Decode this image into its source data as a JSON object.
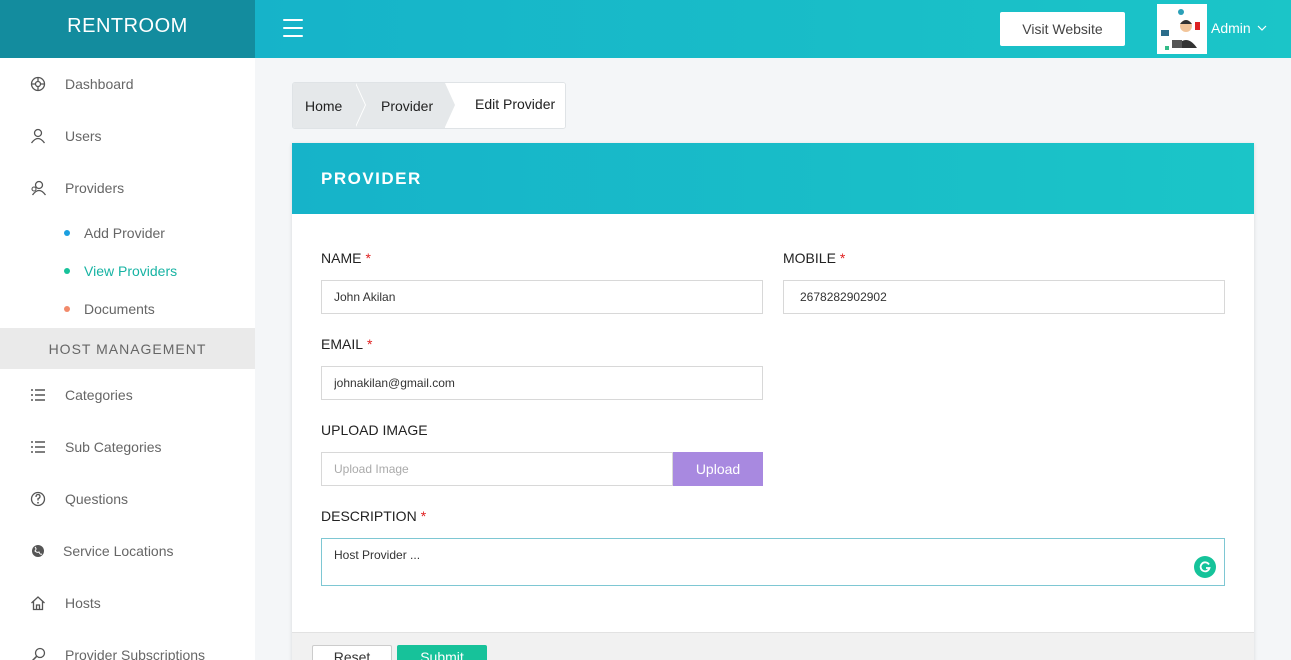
{
  "app": {
    "brand": "RENTROOM"
  },
  "header": {
    "visit_label": "Visit Website",
    "user_label": "Admin"
  },
  "sidebar": {
    "items": [
      {
        "label": "Dashboard",
        "icon": "dashboard-icon"
      },
      {
        "label": "Users",
        "icon": "user-icon"
      },
      {
        "label": "Providers",
        "icon": "providers-icon"
      }
    ],
    "sub_items": [
      {
        "label": "Add Provider",
        "dot_color": "#1a9fe0"
      },
      {
        "label": "View Providers",
        "dot_color": "#17c29a",
        "active": true
      },
      {
        "label": "Documents",
        "dot_color": "#f28a6a"
      }
    ],
    "section_title": "HOST MANAGEMENT",
    "host_items": [
      {
        "label": "Categories",
        "icon": "list-icon"
      },
      {
        "label": "Sub Categories",
        "icon": "list-icon"
      },
      {
        "label": "Questions",
        "icon": "question-icon"
      },
      {
        "label": "Service Locations",
        "icon": "globe-icon"
      },
      {
        "label": "Hosts",
        "icon": "home-icon"
      },
      {
        "label": "Provider Subscriptions",
        "icon": "search-icon"
      }
    ]
  },
  "breadcrumb": {
    "home": "Home",
    "provider": "Provider",
    "current": "Edit Provider"
  },
  "form": {
    "title": "PROVIDER",
    "name_label": "NAME",
    "name_value": "John Akilan",
    "mobile_label": "MOBILE",
    "mobile_value": "2678282902902",
    "email_label": "EMAIL",
    "email_value": "johnakilan@gmail.com",
    "upload_label": "UPLOAD IMAGE",
    "upload_placeholder": "Upload Image",
    "upload_button": "Upload",
    "description_label": "DESCRIPTION",
    "description_value": "Host Provider ...",
    "required_mark": "*",
    "reset_label": "Reset",
    "submit_label": "Submit"
  },
  "colors": {
    "accent": "#16b3c9",
    "brand_bg": "#138c9e",
    "upload": "#a889e0",
    "submit": "#17c29a",
    "required": "#e02020"
  }
}
